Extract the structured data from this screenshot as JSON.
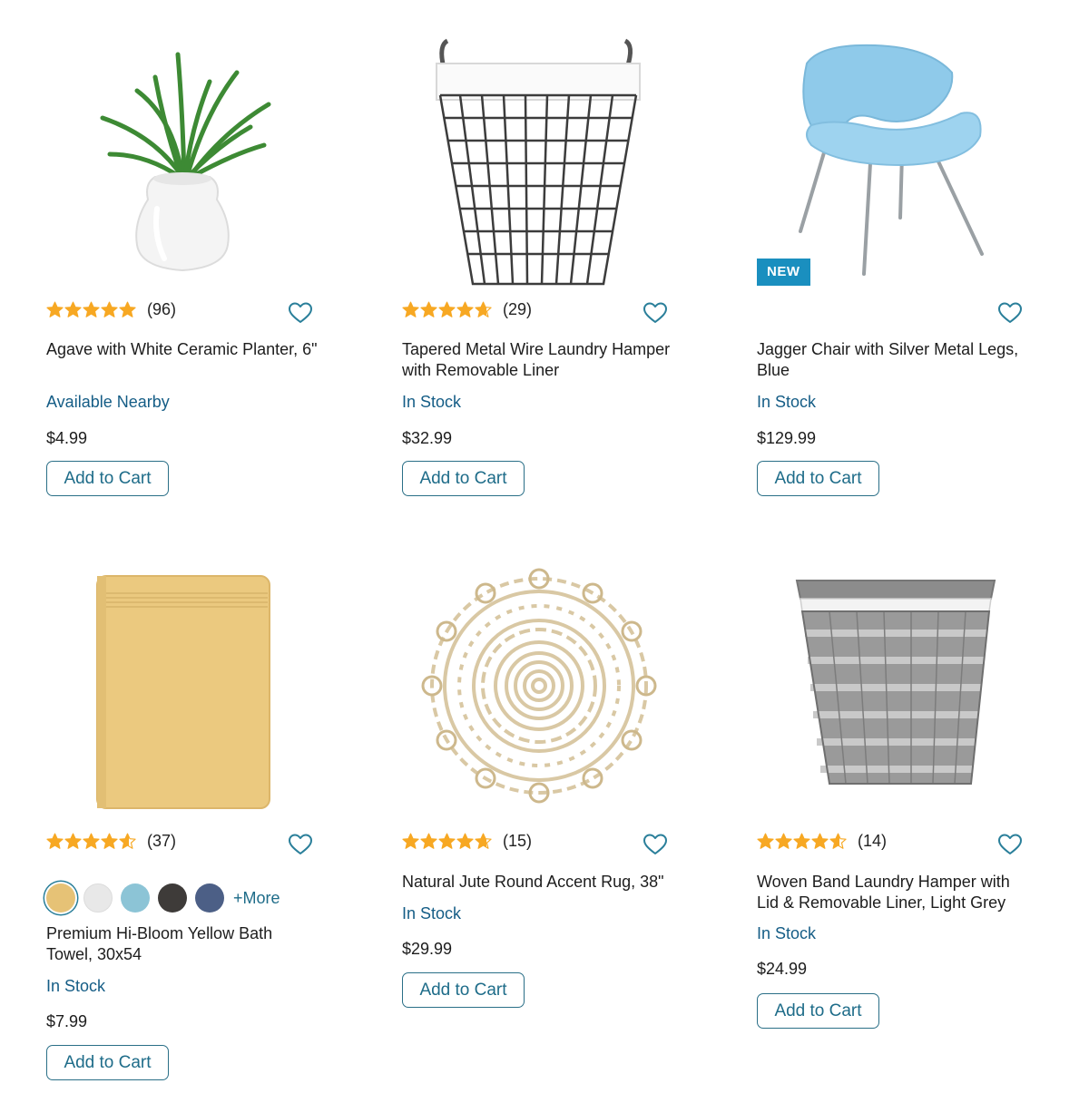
{
  "colors": {
    "star": "#f7a823",
    "link": "#1e6c89",
    "stock": "#155d86",
    "badge": "#1a8fbf",
    "heart": "#2a7f9a"
  },
  "products": [
    {
      "rating": 5.0,
      "review_count": "(96)",
      "title": "Agave with White Ceramic Planter, 6\"",
      "stock": "Available Nearby",
      "price": "$4.99",
      "cart_label": "Add to Cart",
      "image_icon": "agave-plant-icon"
    },
    {
      "rating": 4.7,
      "review_count": "(29)",
      "title": "Tapered Metal Wire Laundry Hamper with Removable Liner",
      "stock": "In Stock",
      "price": "$32.99",
      "cart_label": "Add to Cart",
      "image_icon": "wire-hamper-icon"
    },
    {
      "badge": "NEW",
      "title": "Jagger Chair with Silver Metal Legs, Blue",
      "stock": "In Stock",
      "price": "$129.99",
      "cart_label": "Add to Cart",
      "image_icon": "blue-chair-icon"
    },
    {
      "rating": 4.6,
      "review_count": "(37)",
      "swatches": [
        "#e6c276",
        "#e8e8e8",
        "#8cc4d6",
        "#3e3b39",
        "#4c5f86"
      ],
      "more_label": "+More",
      "title": "Premium Hi-Bloom Yellow Bath Towel, 30x54",
      "stock": "In Stock",
      "price": "$7.99",
      "cart_label": "Add to Cart",
      "image_icon": "yellow-towel-icon"
    },
    {
      "rating": 4.7,
      "review_count": "(15)",
      "title": "Natural Jute Round Accent Rug, 38\"",
      "stock": "In Stock",
      "price": "$29.99",
      "cart_label": "Add to Cart",
      "image_icon": "jute-rug-icon"
    },
    {
      "rating": 4.6,
      "review_count": "(14)",
      "title": "Woven Band Laundry Hamper with Lid & Removable Liner, Light Grey",
      "stock": "In Stock",
      "price": "$24.99",
      "cart_label": "Add to Cart",
      "image_icon": "woven-hamper-icon"
    }
  ]
}
